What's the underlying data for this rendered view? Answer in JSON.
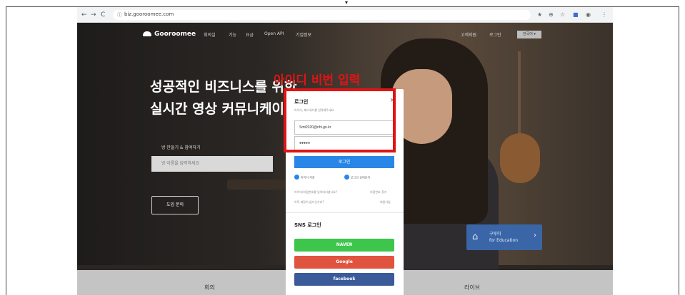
{
  "browser": {
    "url": "biz.gooroomee.com",
    "back_glyph": "←",
    "forward_glyph": "→",
    "reload_glyph": "C",
    "lock_glyph": "ⓘ",
    "toolbar_glyphs": [
      "★",
      "⊕",
      "☆",
      "■",
      "◉",
      "⋮"
    ]
  },
  "nav": {
    "logo": "Gooroomee",
    "items": [
      "회의실",
      "기능",
      "요금",
      "Open API",
      "기업정보"
    ],
    "right_items": [
      "고객지원",
      "로그인"
    ],
    "lang": "한국어 ▾"
  },
  "hero": {
    "headline_1": "성공적인 비즈니스를 위한",
    "headline_2": "실시간 영상 커뮤니케이션",
    "room_label": "방 만들기 & 참여하기",
    "room_placeholder": "방 이름을 입력하세요",
    "intro_button": "도입 문의"
  },
  "annotation": {
    "text": "아이디 비번 입력",
    "color": "#e01414"
  },
  "edu_card": {
    "line1": "구루미",
    "line2": "for Education",
    "icon": "school-icon",
    "arrow": "›"
  },
  "bottom_bar": {
    "items": [
      "회의",
      "라이브"
    ]
  },
  "modal": {
    "title": "로그인",
    "close": "×",
    "subtitle": "아이디, 패스워드를 입력해주세요.",
    "email_value": "Smt2020@nhi.go.kr",
    "password_value": "●●●●●",
    "login_button": "로그인",
    "checkbox_1": "아이디 저장",
    "checkbox_2": "로그인 상태유지",
    "link_forgot_id": "아이디/비밀번호를 잊어버리셨나요?",
    "link_find": "비밀번호 찾기",
    "link_no_account": "아직 계정이 없으신가요?",
    "link_signup": "회원가입",
    "sns_title": "SNS 로그인",
    "naver": "NAVER",
    "google": "Google",
    "facebook": "facebook"
  },
  "colors": {
    "naver": "#3ec64c",
    "google": "#e0533f",
    "facebook": "#3b5a9a",
    "login_blue": "#2a86e6",
    "edu_blue": "#3a66a8"
  },
  "top_caret": "▾"
}
